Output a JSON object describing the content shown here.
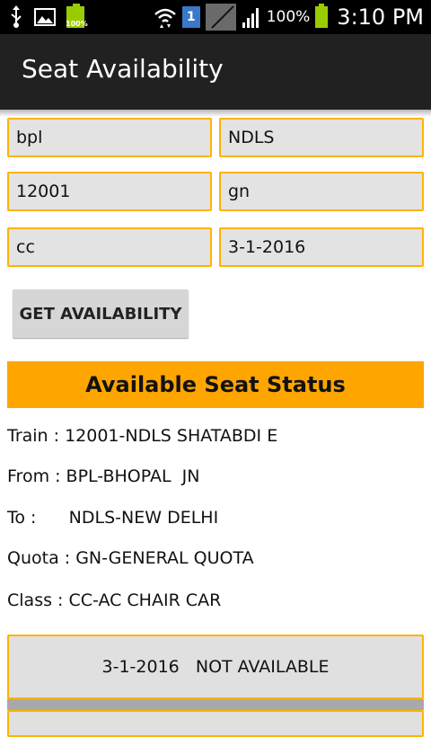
{
  "status_bar": {
    "battery_small_label": "100%",
    "sim_number": "1",
    "battery_percent": "100%",
    "time": "3:10 PM"
  },
  "action_bar": {
    "title": "Seat Availability"
  },
  "form": {
    "from_station": "bpl",
    "to_station": "NDLS",
    "train_number": "12001",
    "quota": "gn",
    "class": "cc",
    "date": "3-1-2016",
    "get_button_label": "GET AVAILABILITY"
  },
  "result": {
    "header": "Available Seat Status",
    "train": "Train : 12001-NDLS SHATABDI E",
    "from": "From : BPL-BHOPAL  JN",
    "to": "To :      NDLS-NEW DELHI",
    "quota": "Quota : GN-GENERAL QUOTA",
    "class": "Class : CC-AC CHAIR CAR",
    "availability": [
      {
        "label": "3-1-2016   NOT AVAILABLE"
      }
    ]
  },
  "colors": {
    "accent": "#ffa500",
    "field_border": "#ffb300",
    "action_bar": "#212121"
  }
}
